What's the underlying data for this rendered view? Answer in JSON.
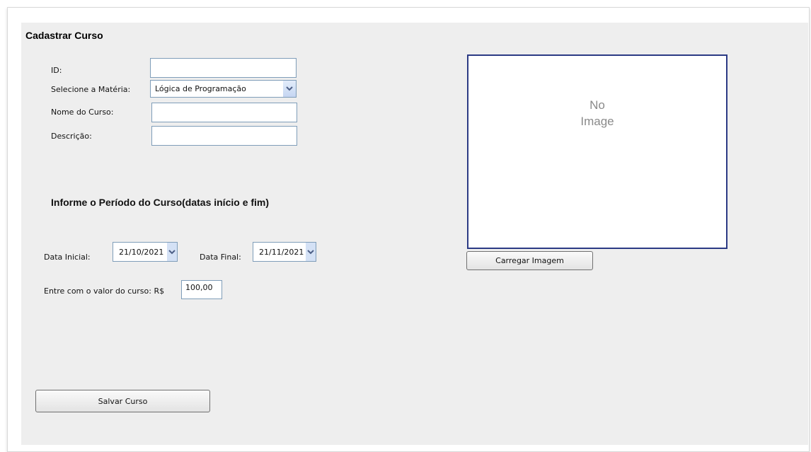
{
  "form": {
    "title": "Cadastrar Curso",
    "fields": {
      "id_label": "ID:",
      "id_value": "",
      "materia_label": "Selecione a Matéria:",
      "materia_value": "Lógica de Programação",
      "nome_label": "Nome do Curso:",
      "nome_value": "",
      "descricao_label": "Descrição:",
      "descricao_value": ""
    },
    "period": {
      "heading": "Informe o Período do Curso(datas início e fim)",
      "start_label": "Data Inicial:",
      "start_value": "21/10/2021",
      "end_label": "Data Final:",
      "end_value": "21/11/2021"
    },
    "price": {
      "label": "Entre com o valor do curso: R$",
      "value": "100,00"
    },
    "save_button": "Salvar Curso"
  },
  "image": {
    "placeholder_line1": "No",
    "placeholder_line2": "Image",
    "load_button": "Carregar Imagem"
  },
  "colors": {
    "panel_bg": "#eeeeee",
    "input_border": "#7f9db9",
    "image_border": "#2b3a84"
  },
  "icons": {
    "dropdown": "chevron-down-icon"
  }
}
